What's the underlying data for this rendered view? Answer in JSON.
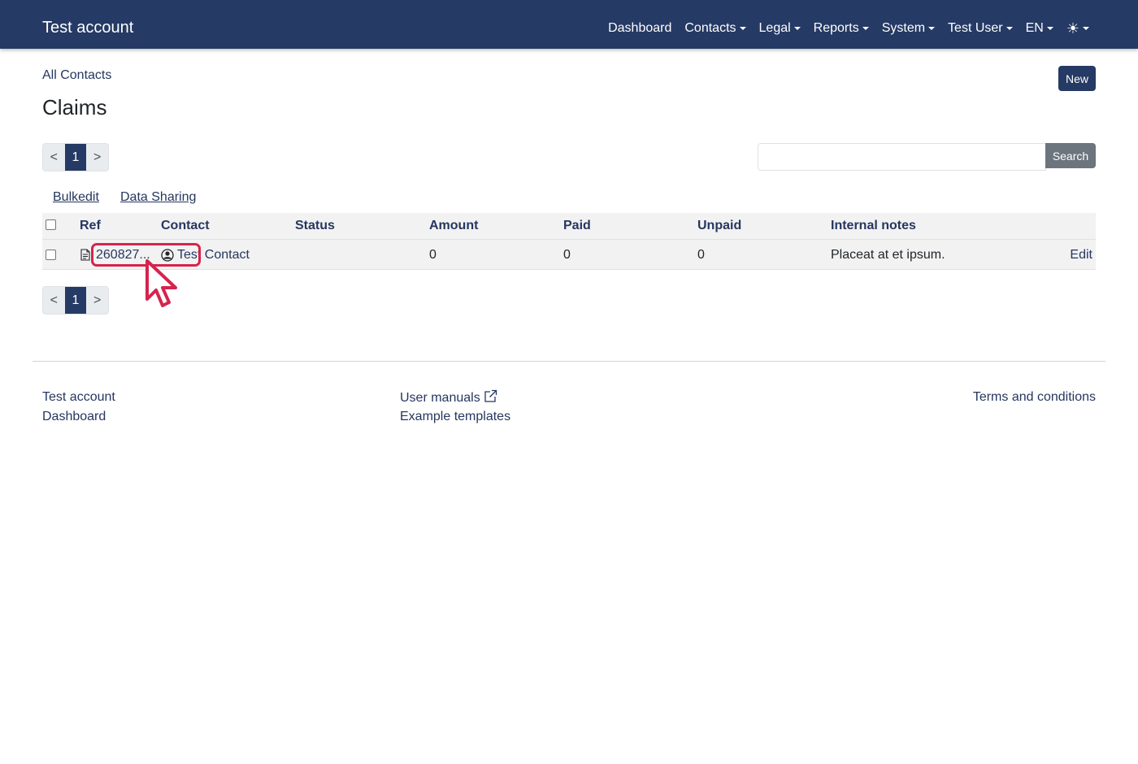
{
  "navbar": {
    "brand": "Test account",
    "items": [
      {
        "label": "Dashboard",
        "dropdown": false
      },
      {
        "label": "Contacts",
        "dropdown": true
      },
      {
        "label": "Legal",
        "dropdown": true
      },
      {
        "label": "Reports",
        "dropdown": true
      },
      {
        "label": "System",
        "dropdown": true
      },
      {
        "label": "Test User",
        "dropdown": true
      },
      {
        "label": "EN",
        "dropdown": true
      }
    ],
    "theme_icon": "☀",
    "bg_color": "#253a64"
  },
  "breadcrumb": "All Contacts",
  "new_button": "New",
  "page_title": "Claims",
  "pagination": {
    "prev": "<",
    "current": "1",
    "next": ">"
  },
  "search": {
    "value": "",
    "placeholder": "",
    "button": "Search"
  },
  "tools": {
    "bulkedit": "Bulkedit",
    "data_sharing": "Data Sharing"
  },
  "table": {
    "headers": [
      "Ref",
      "Contact",
      "Status",
      "Amount",
      "Paid",
      "Unpaid",
      "Internal notes"
    ],
    "rows": [
      {
        "ref": "260827...",
        "contact": "Test Contact",
        "status": "",
        "amount": "0",
        "paid": "0",
        "unpaid": "0",
        "internal_notes": "Placeat at et ipsum.",
        "action": "Edit"
      }
    ]
  },
  "footer": {
    "col1": [
      "Test account",
      "Dashboard"
    ],
    "col2": [
      "User manuals",
      "Example templates"
    ],
    "col3": [
      "Terms and conditions"
    ]
  },
  "colors": {
    "accent": "#253a64",
    "highlight": "#d6234d",
    "secondary": "#6c757d"
  }
}
